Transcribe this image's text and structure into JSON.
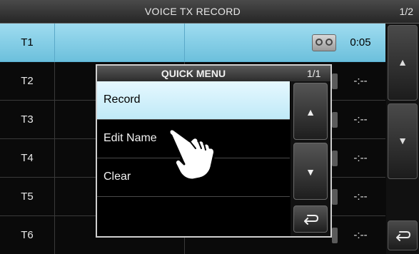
{
  "title": "VOICE TX RECORD",
  "page": "1/2",
  "rows": [
    {
      "label": "T1",
      "time": "0:05"
    },
    {
      "label": "T2",
      "time": "-:--"
    },
    {
      "label": "T3",
      "time": "-:--"
    },
    {
      "label": "T4",
      "time": "-:--"
    },
    {
      "label": "T5",
      "time": "-:--"
    },
    {
      "label": "T6",
      "time": "-:--"
    }
  ],
  "quick_menu": {
    "title": "QUICK MENU",
    "page": "1/1",
    "items": [
      "Record",
      "Edit Name",
      "Clear",
      ""
    ]
  },
  "icons": {
    "up": "▲",
    "down": "▼",
    "back": "back-arrow-icon",
    "tape": "tape-icon",
    "pointer": "hand-pointer-icon"
  },
  "colors": {
    "selected_row": "#7fcbe5",
    "selected_menu_item": "#cfeefa",
    "background": "#0a0a0a"
  }
}
